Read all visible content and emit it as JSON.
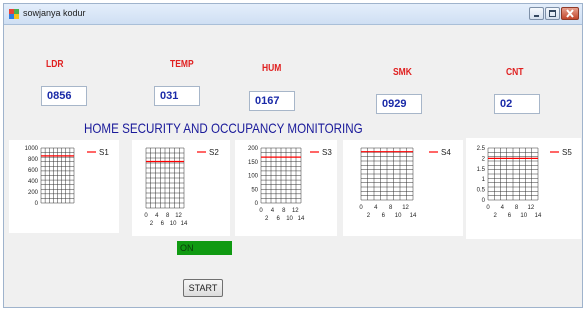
{
  "window": {
    "title": "sowjanya kodur"
  },
  "sensors": [
    {
      "label": "LDR",
      "value": "0856"
    },
    {
      "label": "TEMP",
      "value": "031"
    },
    {
      "label": "HUM",
      "value": "0167"
    },
    {
      "label": "SMK",
      "value": "0929"
    },
    {
      "label": "CNT",
      "value": "02"
    }
  ],
  "heading": "HOME SECURITY AND OCCUPANCY MONITORING",
  "status_text": "ON",
  "start_label": "START",
  "colors": {
    "label_red": "#e02020",
    "value_blue": "#1a2aa8",
    "heading_blue": "#1a1a9a",
    "series_red": "#ff0000",
    "status_green": "#109a12"
  },
  "chart_data": [
    {
      "type": "line",
      "legend": "S1",
      "yticks": [
        "1000",
        "800",
        "600",
        "400",
        "200",
        "0"
      ],
      "xticks": [],
      "ylim": [
        0,
        1000
      ],
      "series": [
        {
          "name": "S1",
          "values": [
            856,
            856,
            856,
            856,
            856
          ]
        }
      ]
    },
    {
      "type": "line",
      "legend": "S2",
      "yticks": [],
      "xticks": [
        "0",
        "2",
        "4",
        "6",
        "8",
        "10",
        "12",
        "14"
      ],
      "ylim": [
        0,
        40
      ],
      "series": [
        {
          "name": "S2",
          "values": [
            31,
            31,
            31,
            31,
            31
          ]
        }
      ]
    },
    {
      "type": "line",
      "legend": "S3",
      "yticks": [
        "200",
        "150",
        "100",
        "50",
        "0"
      ],
      "xticks": [
        "0",
        "2",
        "4",
        "6",
        "8",
        "10",
        "12",
        "14"
      ],
      "ylim": [
        0,
        200
      ],
      "series": [
        {
          "name": "S3",
          "values": [
            167,
            167,
            167,
            167,
            167
          ]
        }
      ]
    },
    {
      "type": "line",
      "legend": "S4",
      "yticks": [],
      "xticks": [
        "0",
        "2",
        "4",
        "6",
        "8",
        "10",
        "12",
        "14"
      ],
      "ylim": [
        0,
        1000
      ],
      "series": [
        {
          "name": "S4",
          "values": [
            929,
            929,
            929,
            929,
            929
          ]
        }
      ]
    },
    {
      "type": "line",
      "legend": "S5",
      "yticks": [
        "2.5",
        "2",
        "1.5",
        "1",
        "0.5",
        "0"
      ],
      "xticks": [
        "0",
        "2",
        "4",
        "6",
        "8",
        "10",
        "12",
        "14"
      ],
      "ylim": [
        0,
        2.5
      ],
      "series": [
        {
          "name": "S5",
          "values": [
            2,
            2,
            2,
            2,
            2
          ]
        }
      ]
    }
  ]
}
